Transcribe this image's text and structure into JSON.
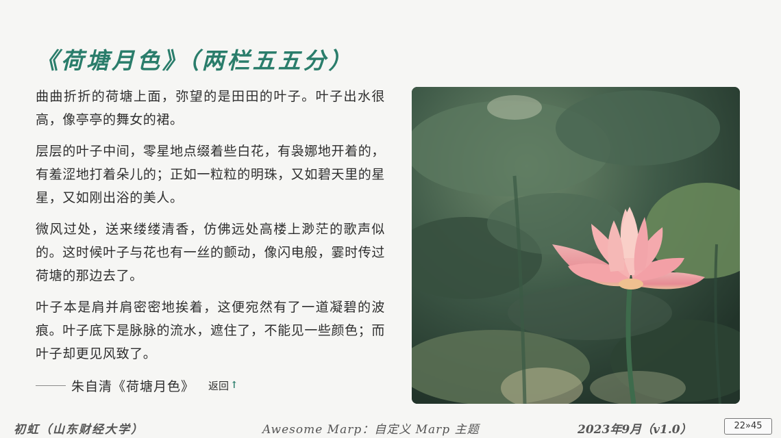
{
  "slide": {
    "title": "《荷塘月色》（两栏五五分）"
  },
  "content": {
    "paragraphs": [
      "曲曲折折的荷塘上面，弥望的是田田的叶子。叶子出水很高，像亭亭的舞女的裙。",
      "层层的叶子中间，零星地点缀着些白花，有袅娜地开着的，有羞涩地打着朵儿的；正如一粒粒的明珠，又如碧天里的星星，又如刚出浴的美人。",
      "微风过处，送来缕缕清香，仿佛远处高楼上渺茫的歌声似的。这时候叶子与花也有一丝的颤动，像闪电般，霎时传过荷塘的那边去了。",
      "叶子本是肩并肩密密地挨着，这便宛然有了一道凝碧的波痕。叶子底下是脉脉的流水，遮住了，不能见一些颜色；而叶子却更见风致了。"
    ],
    "attribution": "朱自清《荷塘月色》",
    "back_link": "返回",
    "back_icon": "up-arrow-icon"
  },
  "image": {
    "subject": "lotus-flower-icon",
    "colors": {
      "leaf_dark": "#2f4a3c",
      "leaf_light": "#5a7a5e",
      "petal_pink": "#f19aa0",
      "petal_light": "#f8c6c0",
      "stem": "#3e6b4c"
    }
  },
  "footer": {
    "left": "初虹（山东财经大学）",
    "center": "Awesome Marp：自定义 Marp 主题",
    "right": "2023年9月（v1.0）",
    "page": "22»45"
  },
  "colors": {
    "accent": "#2a7d6b",
    "background": "#f6f6f4",
    "text": "#2e2e2e"
  }
}
